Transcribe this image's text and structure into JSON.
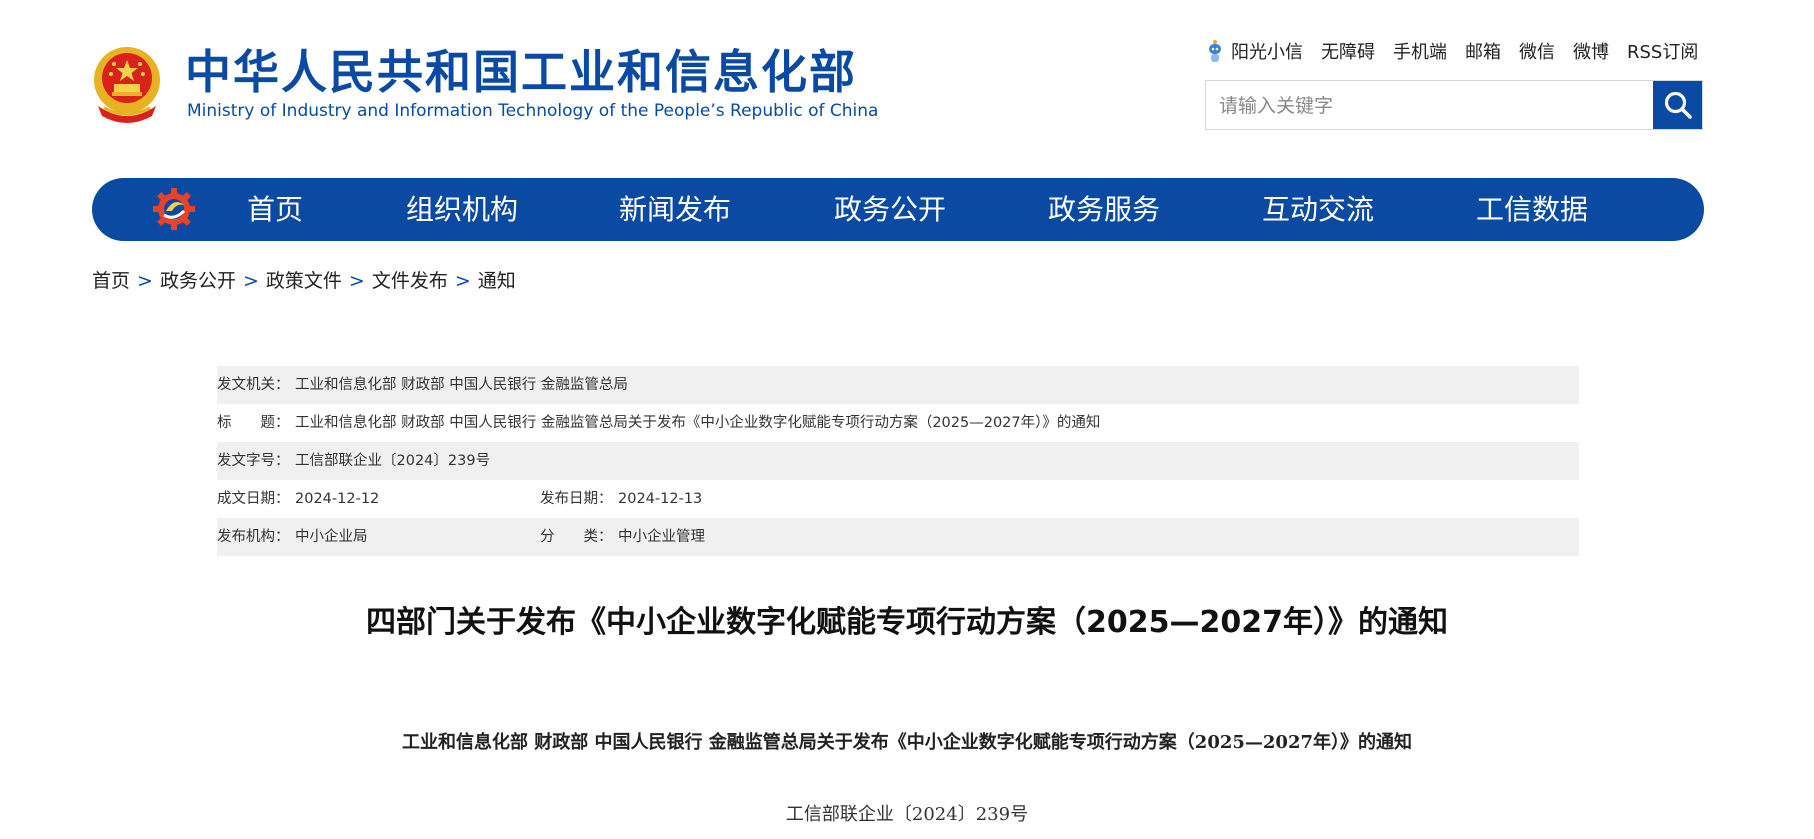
{
  "header": {
    "logo_cn": "中华人民共和国工业和信息化部",
    "logo_en": "Ministry of Industry and Information Technology of the People’s Republic of China",
    "top_links": [
      "阳光小信",
      "无障碍",
      "手机端",
      "邮箱",
      "微信",
      "微博",
      "RSS订阅"
    ],
    "search_placeholder": "请输入关键字"
  },
  "nav": {
    "items": [
      "首页",
      "组织机构",
      "新闻发布",
      "政务公开",
      "政务服务",
      "互动交流",
      "工信数据"
    ]
  },
  "breadcrumb": [
    "首页",
    "政务公开",
    "政策文件",
    "文件发布",
    "通知"
  ],
  "meta": {
    "issuer_label": "发文机关：",
    "issuer": "工业和信息化部 财政部 中国人民银行 金融监管总局",
    "title_label": "标　　题：",
    "title": "工业和信息化部 财政部 中国人民银行 金融监管总局关于发布《中小企业数字化赋能专项行动方案（2025—2027年）》的通知",
    "docno_label": "发文字号：",
    "docno": "工信部联企业〔2024〕239号",
    "created_label": "成文日期：",
    "created": "2024-12-12",
    "published_label": "发布日期：",
    "published": "2024-12-13",
    "agency_label": "发布机构：",
    "agency": "中小企业局",
    "category_label": "分　　类：",
    "category": "中小企业管理"
  },
  "article": {
    "title": "四部门关于发布《中小企业数字化赋能专项行动方案（2025—2027年）》的通知",
    "subtitle": "工业和信息化部 财政部 中国人民银行 金融监管总局关于发布《中小企业数字化赋能专项行动方案（2025—2027年）》的通知",
    "docno": "工信部联企业〔2024〕239号"
  },
  "colors": {
    "brand": "#0b4aa2",
    "row_shade": "#f0f0f0"
  }
}
